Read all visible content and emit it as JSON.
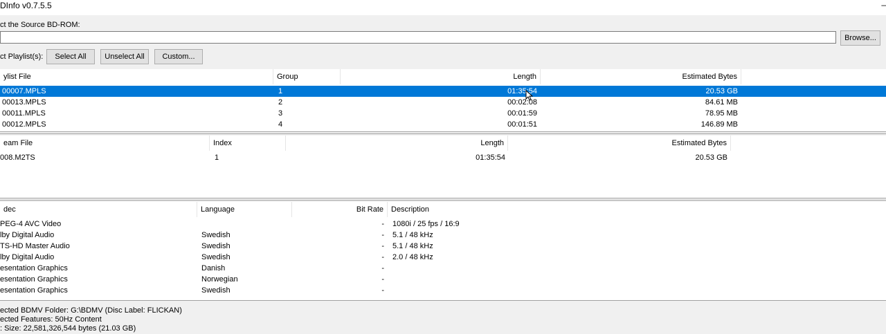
{
  "window": {
    "title": "DInfo v0.7.5.5",
    "minimize_glyph": "–"
  },
  "source": {
    "label": "ct the Source BD-ROM:",
    "path_value": "",
    "browse_label": "Browse..."
  },
  "playlist_controls": {
    "label": "ct Playlist(s):",
    "select_all": "Select All",
    "unselect_all": "Unselect All",
    "custom": "Custom..."
  },
  "playlists": {
    "headers": {
      "file": "ylist File",
      "group": "Group",
      "length": "Length",
      "bytes": "Estimated Bytes"
    },
    "rows": [
      {
        "file": "00007.MPLS",
        "group": "1",
        "length": "01:35:54",
        "bytes": "20.53 GB",
        "selected": true
      },
      {
        "file": "00013.MPLS",
        "group": "2",
        "length": "00:02:08",
        "bytes": "84.61 MB"
      },
      {
        "file": "00011.MPLS",
        "group": "3",
        "length": "00:01:59",
        "bytes": "78.95 MB"
      },
      {
        "file": "00012.MPLS",
        "group": "4",
        "length": "00:01:51",
        "bytes": "146.89 MB"
      }
    ]
  },
  "streams": {
    "headers": {
      "file": "eam File",
      "index": "Index",
      "length": "Length",
      "bytes": "Estimated Bytes"
    },
    "rows": [
      {
        "file": "008.M2TS",
        "index": "1",
        "length": "01:35:54",
        "bytes": "20.53 GB"
      }
    ]
  },
  "codecs": {
    "headers": {
      "codec": "dec",
      "language": "Language",
      "bitrate": "Bit Rate",
      "description": "Description"
    },
    "rows": [
      {
        "codec": "PEG-4 AVC Video",
        "language": "",
        "bitrate": "-",
        "description": "1080i / 25 fps / 16:9"
      },
      {
        "codec": "lby Digital Audio",
        "language": "Swedish",
        "bitrate": "-",
        "description": "5.1 / 48 kHz"
      },
      {
        "codec": "TS-HD Master Audio",
        "language": "Swedish",
        "bitrate": "-",
        "description": "5.1 / 48 kHz"
      },
      {
        "codec": "lby Digital Audio",
        "language": "Swedish",
        "bitrate": "-",
        "description": "2.0 / 48 kHz"
      },
      {
        "codec": "esentation Graphics",
        "language": "Danish",
        "bitrate": "-",
        "description": ""
      },
      {
        "codec": "esentation Graphics",
        "language": "Norwegian",
        "bitrate": "-",
        "description": ""
      },
      {
        "codec": "esentation Graphics",
        "language": "Swedish",
        "bitrate": "-",
        "description": ""
      }
    ]
  },
  "status": {
    "lines": [
      "ected BDMV Folder: G:\\BDMV (Disc Label: FLICKAN)",
      "ected Features: 50Hz Content",
      ": Size: 22,581,326,544 bytes (21.03 GB)"
    ]
  },
  "colors": {
    "selection": "#0078d7",
    "window_bg": "#f0f0f0"
  },
  "icons": {
    "cursor": "mouse-pointer-icon"
  }
}
